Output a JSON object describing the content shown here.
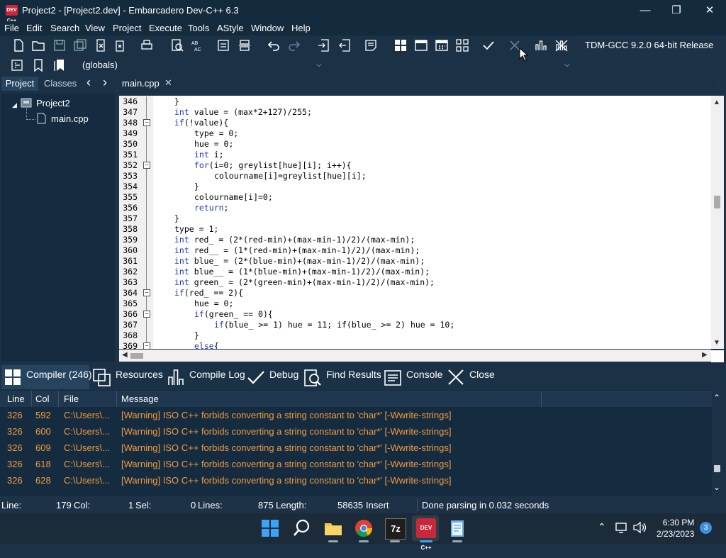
{
  "window": {
    "title": "Project2 - [Project2.dev] - Embarcadero Dev-C++ 6.3",
    "logo_text": "DEV C++",
    "minimize": "—",
    "maximize": "❐",
    "close": "✕"
  },
  "menu": [
    "File",
    "Edit",
    "Search",
    "View",
    "Project",
    "Execute",
    "Tools",
    "AStyle",
    "Window",
    "Help"
  ],
  "toolbar": {
    "compiler": "TDM-GCC 9.2.0 64-bit Release",
    "scope": "(globals)"
  },
  "left_panel": {
    "tabs": [
      "Project",
      "Classes"
    ],
    "nav_prev": "‹",
    "nav_next": "›",
    "tree": {
      "project": "Project2",
      "file": "main.cpp"
    }
  },
  "editor": {
    "tab": "main.cpp",
    "tab_close": "✕",
    "lines": [
      {
        "n": "346",
        "text": "}",
        "indent": 1
      },
      {
        "n": "347",
        "kw": "int",
        "text": " value = (max*2+127)/255;",
        "indent": 1
      },
      {
        "n": "348",
        "kw": "if",
        "text": "(!value){",
        "indent": 1,
        "fold": true
      },
      {
        "n": "349",
        "text": "type = 0;",
        "indent": 2
      },
      {
        "n": "350",
        "text": "hue = 0;",
        "indent": 2
      },
      {
        "n": "351",
        "kw": "int",
        "text": " i;",
        "indent": 2
      },
      {
        "n": "352",
        "kw": "for",
        "text": "(i=0; greylist[hue][i]; i++){",
        "indent": 2,
        "fold": true
      },
      {
        "n": "353",
        "text": "colourname[i]=greylist[hue][i];",
        "indent": 3
      },
      {
        "n": "354",
        "text": "}",
        "indent": 2
      },
      {
        "n": "355",
        "text": "colourname[i]=0;",
        "indent": 2
      },
      {
        "n": "356",
        "kw": "return",
        "text": ";",
        "indent": 2
      },
      {
        "n": "357",
        "text": "}",
        "indent": 1
      },
      {
        "n": "358",
        "text": "type = 1;",
        "indent": 1
      },
      {
        "n": "359",
        "kw": "int",
        "text": " red_ = (2*(red-min)+(max-min-1)/2)/(max-min);",
        "indent": 1
      },
      {
        "n": "360",
        "kw": "int",
        "text": " red__ = (1*(red-min)+(max-min-1)/2)/(max-min);",
        "indent": 1
      },
      {
        "n": "361",
        "kw": "int",
        "text": " blue_ = (2*(blue-min)+(max-min-1)/2)/(max-min);",
        "indent": 1
      },
      {
        "n": "362",
        "kw": "int",
        "text": " blue__ = (1*(blue-min)+(max-min-1)/2)/(max-min);",
        "indent": 1
      },
      {
        "n": "363",
        "kw": "int",
        "text": " green_ = (2*(green-min)+(max-min-1)/2)/(max-min);",
        "indent": 1
      },
      {
        "n": "364",
        "kw": "if",
        "text": "(red_ == 2){",
        "indent": 1,
        "fold": true
      },
      {
        "n": "365",
        "text": "hue = 0;",
        "indent": 2
      },
      {
        "n": "366",
        "kw": "if",
        "text": "(green_ == 0){",
        "indent": 2,
        "fold": true
      },
      {
        "n": "367",
        "kw": "if",
        "text": "(blue_ >= 1) hue = 11; if(blue_ >= 2) hue = 10;",
        "indent": 3
      },
      {
        "n": "368",
        "text": "}",
        "indent": 2
      },
      {
        "n": "369",
        "kw": "else",
        "text": "{",
        "indent": 2,
        "fold": true
      }
    ]
  },
  "bottom_tabs": [
    "Compiler (246)",
    "Resources",
    "Compile Log",
    "Debug",
    "Find Results",
    "Console",
    "Close"
  ],
  "messages": {
    "headers": [
      "Line",
      "Col",
      "File",
      "Message"
    ],
    "rows": [
      {
        "line": "326",
        "col": "592",
        "file": "C:\\Users\\...",
        "msg": "[Warning] ISO C++ forbids converting a string constant to 'char*' [-Wwrite-strings]"
      },
      {
        "line": "326",
        "col": "600",
        "file": "C:\\Users\\...",
        "msg": "[Warning] ISO C++ forbids converting a string constant to 'char*' [-Wwrite-strings]"
      },
      {
        "line": "326",
        "col": "609",
        "file": "C:\\Users\\...",
        "msg": "[Warning] ISO C++ forbids converting a string constant to 'char*' [-Wwrite-strings]"
      },
      {
        "line": "326",
        "col": "618",
        "file": "C:\\Users\\...",
        "msg": "[Warning] ISO C++ forbids converting a string constant to 'char*' [-Wwrite-strings]"
      },
      {
        "line": "326",
        "col": "628",
        "file": "C:\\Users\\...",
        "msg": "[Warning] ISO C++ forbids converting a string constant to 'char*' [-Wwrite-strings]"
      }
    ]
  },
  "status": {
    "line_label": "Line:",
    "line_val": "179",
    "col_label": "Col:",
    "col_val": "1",
    "sel_label": "Sel:",
    "sel_val": "0",
    "lines_label": "Lines:",
    "lines_val": "875",
    "length_label": "Length:",
    "length_val": "58635",
    "mode": "Insert",
    "message": "Done parsing in 0.032 seconds"
  },
  "taskbar": {
    "time": "6:30 PM",
    "date": "2/23/2023",
    "notifications": "3",
    "sevenzip_label": "7z",
    "devcpp_label": "DEV C++"
  },
  "colors": {
    "warning": "#f39a3d",
    "keyword": "#1e39b5",
    "accent": "#26445e"
  }
}
